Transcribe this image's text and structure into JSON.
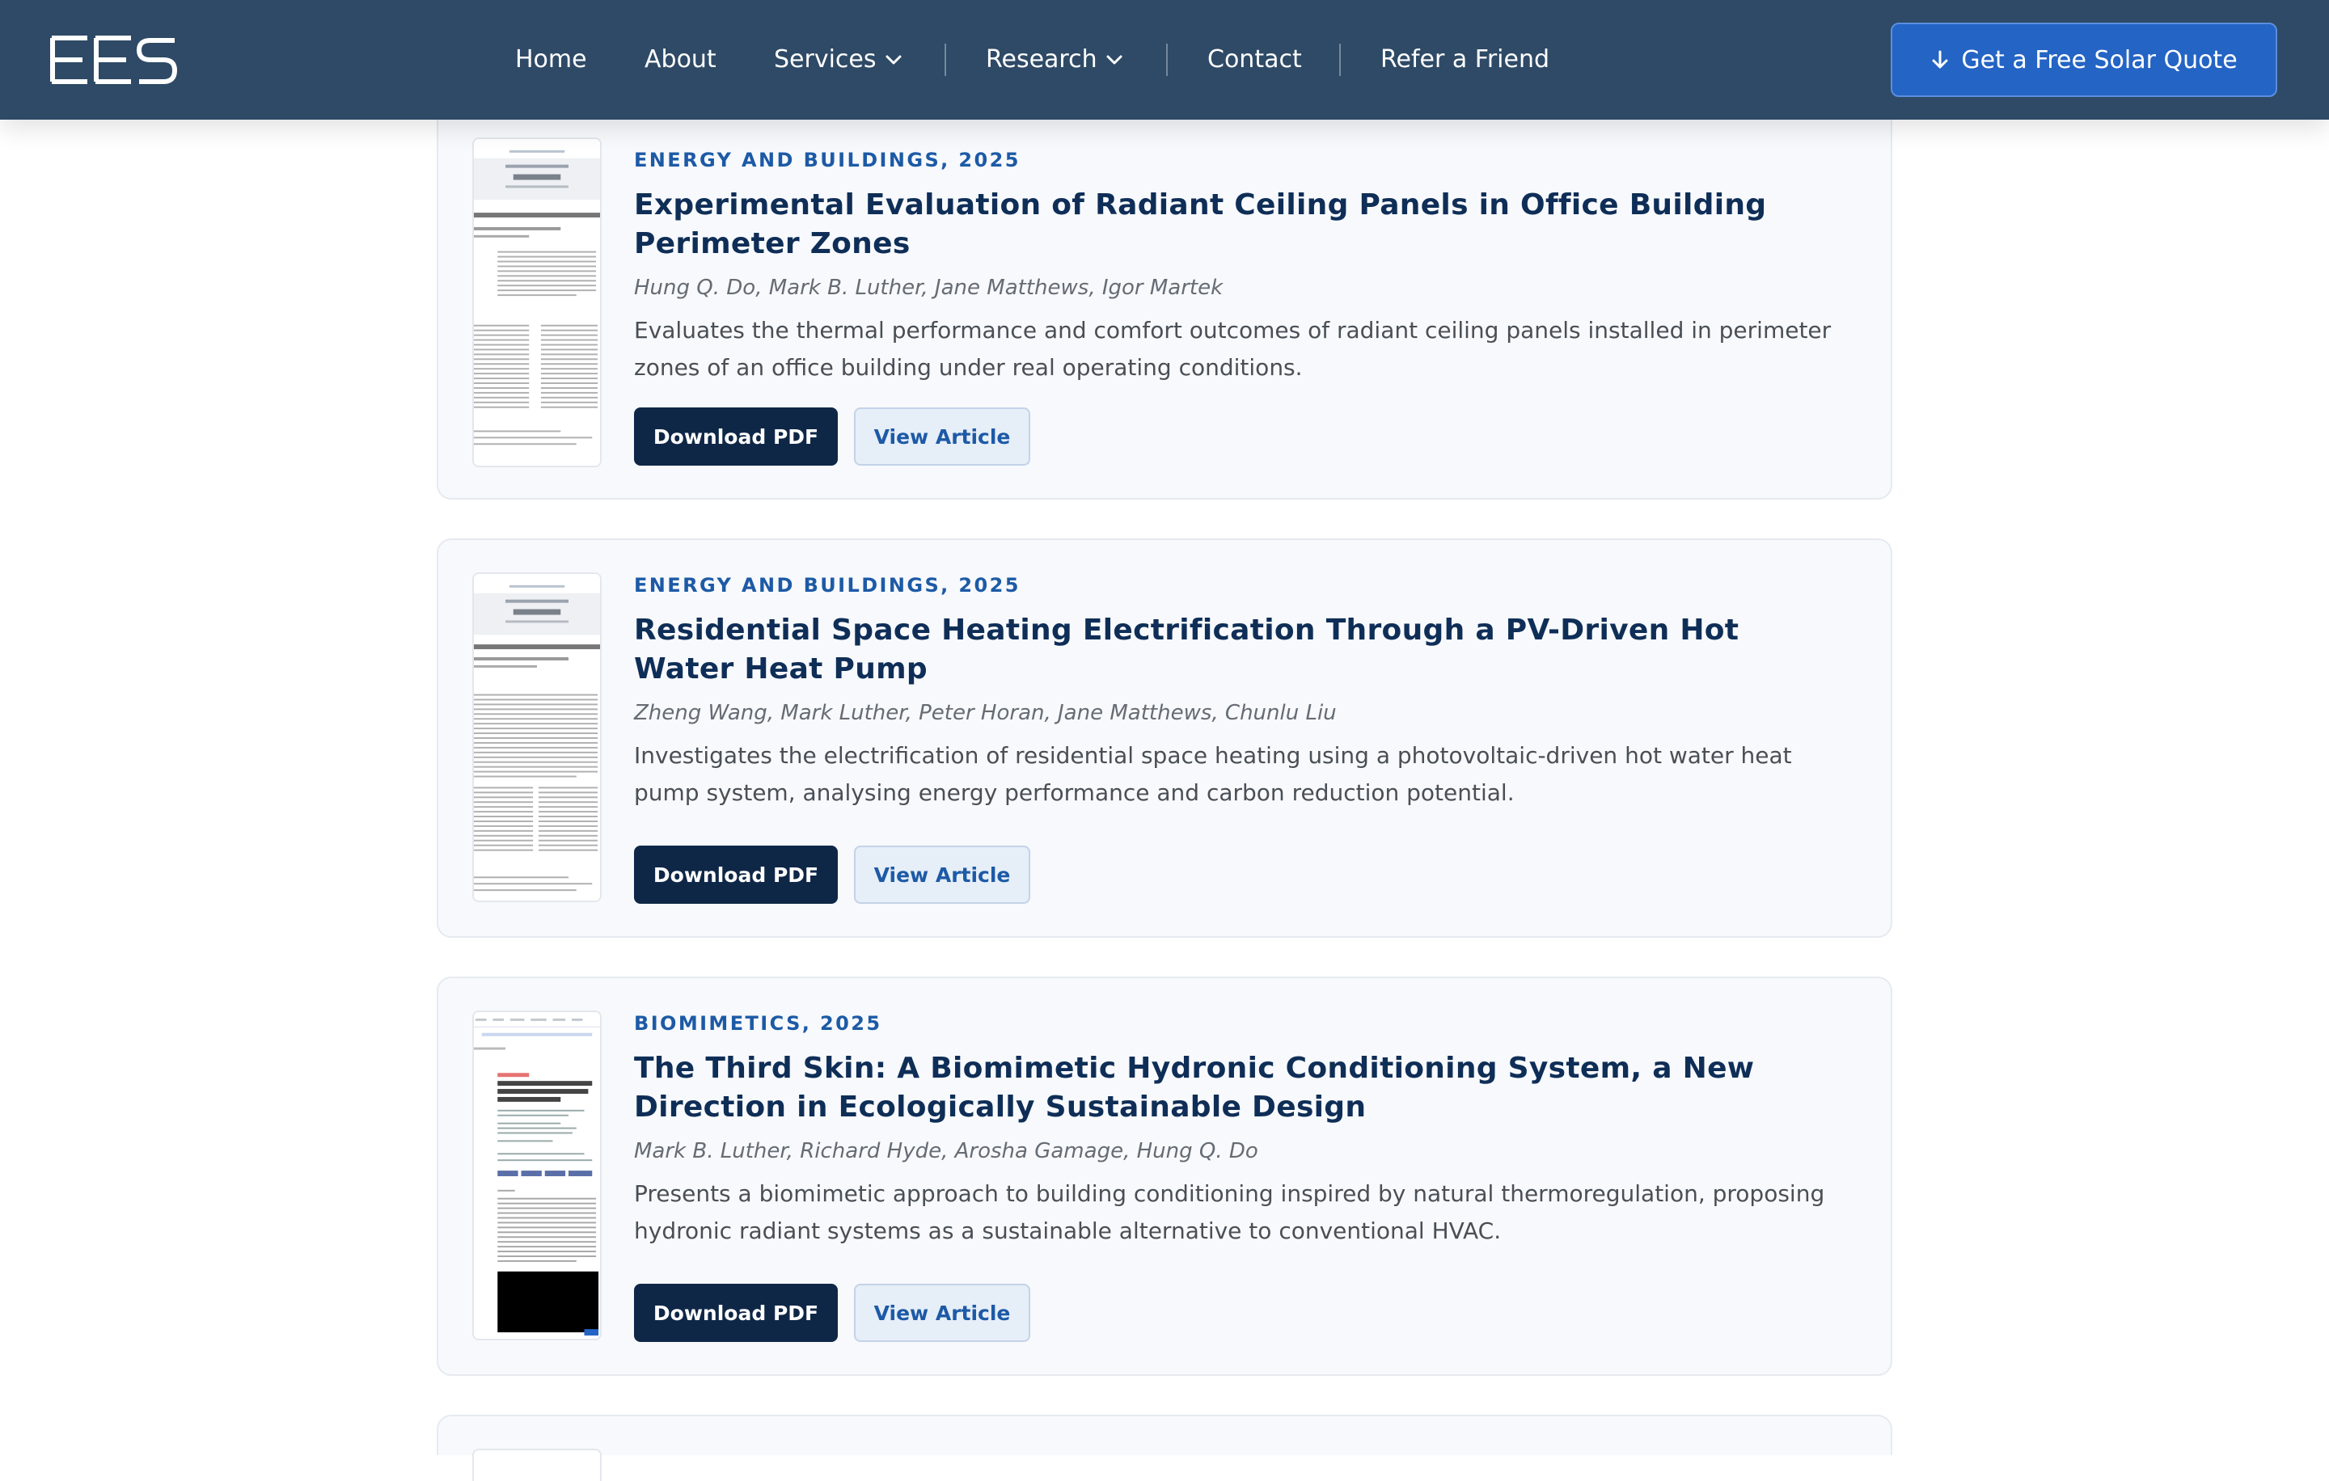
{
  "nav": {
    "logo_text": "EES",
    "links": [
      {
        "label": "Home"
      },
      {
        "label": "About"
      },
      {
        "label": "Services"
      },
      {
        "label": "Research"
      },
      {
        "label": "Contact"
      },
      {
        "label": "Refer a Friend"
      }
    ],
    "cta_label": "Get a Free Solar Quote"
  },
  "articles": [
    {
      "journal": "ENERGY AND BUILDINGS, 2025",
      "title": "Experimental Evaluation of Radiant Ceiling Panels in Office Building Perimeter Zones",
      "authors": "Hung Q. Do, Mark B. Luther, Jane Matthews, Igor Martek",
      "description": "Evaluates the thermal performance and comfort outcomes of radiant ceiling panels installed in perimeter zones of an office building under real operating conditions.",
      "download_label": "Download PDF",
      "view_label": "View Article"
    },
    {
      "journal": "ENERGY AND BUILDINGS, 2025",
      "title": "Residential Space Heating Electrification Through a PV-Driven Hot Water Heat Pump",
      "authors": "Zheng Wang, Mark Luther, Peter Horan, Jane Matthews, Chunlu Liu",
      "description": "Investigates the electrification of residential space heating using a photovoltaic-driven hot water heat pump system, analysing energy performance and carbon reduction potential.",
      "download_label": "Download PDF",
      "view_label": "View Article"
    },
    {
      "journal": "BIOMIMETICS, 2025",
      "title": "The Third Skin: A Biomimetic Hydronic Conditioning System, a New Direction in Ecologically Sustainable Design",
      "authors": "Mark B. Luther, Richard Hyde, Arosha Gamage, Hung Q. Do",
      "description": "Presents a biomimetic approach to building conditioning inspired by natural thermoregulation, proposing hydronic radiant systems as a sustainable alternative to conventional HVAC.",
      "download_label": "Download PDF",
      "view_label": "View Article"
    }
  ],
  "colors": {
    "nav_bg": "#2e4a66",
    "cta_bg": "#2464c4",
    "journal_accent": "#1d5aa6",
    "title_color": "#0f2e57",
    "download_bg": "#0f2747"
  },
  "icons": {
    "cta": "arrow-down-icon",
    "dropdown": "chevron-down-icon"
  }
}
